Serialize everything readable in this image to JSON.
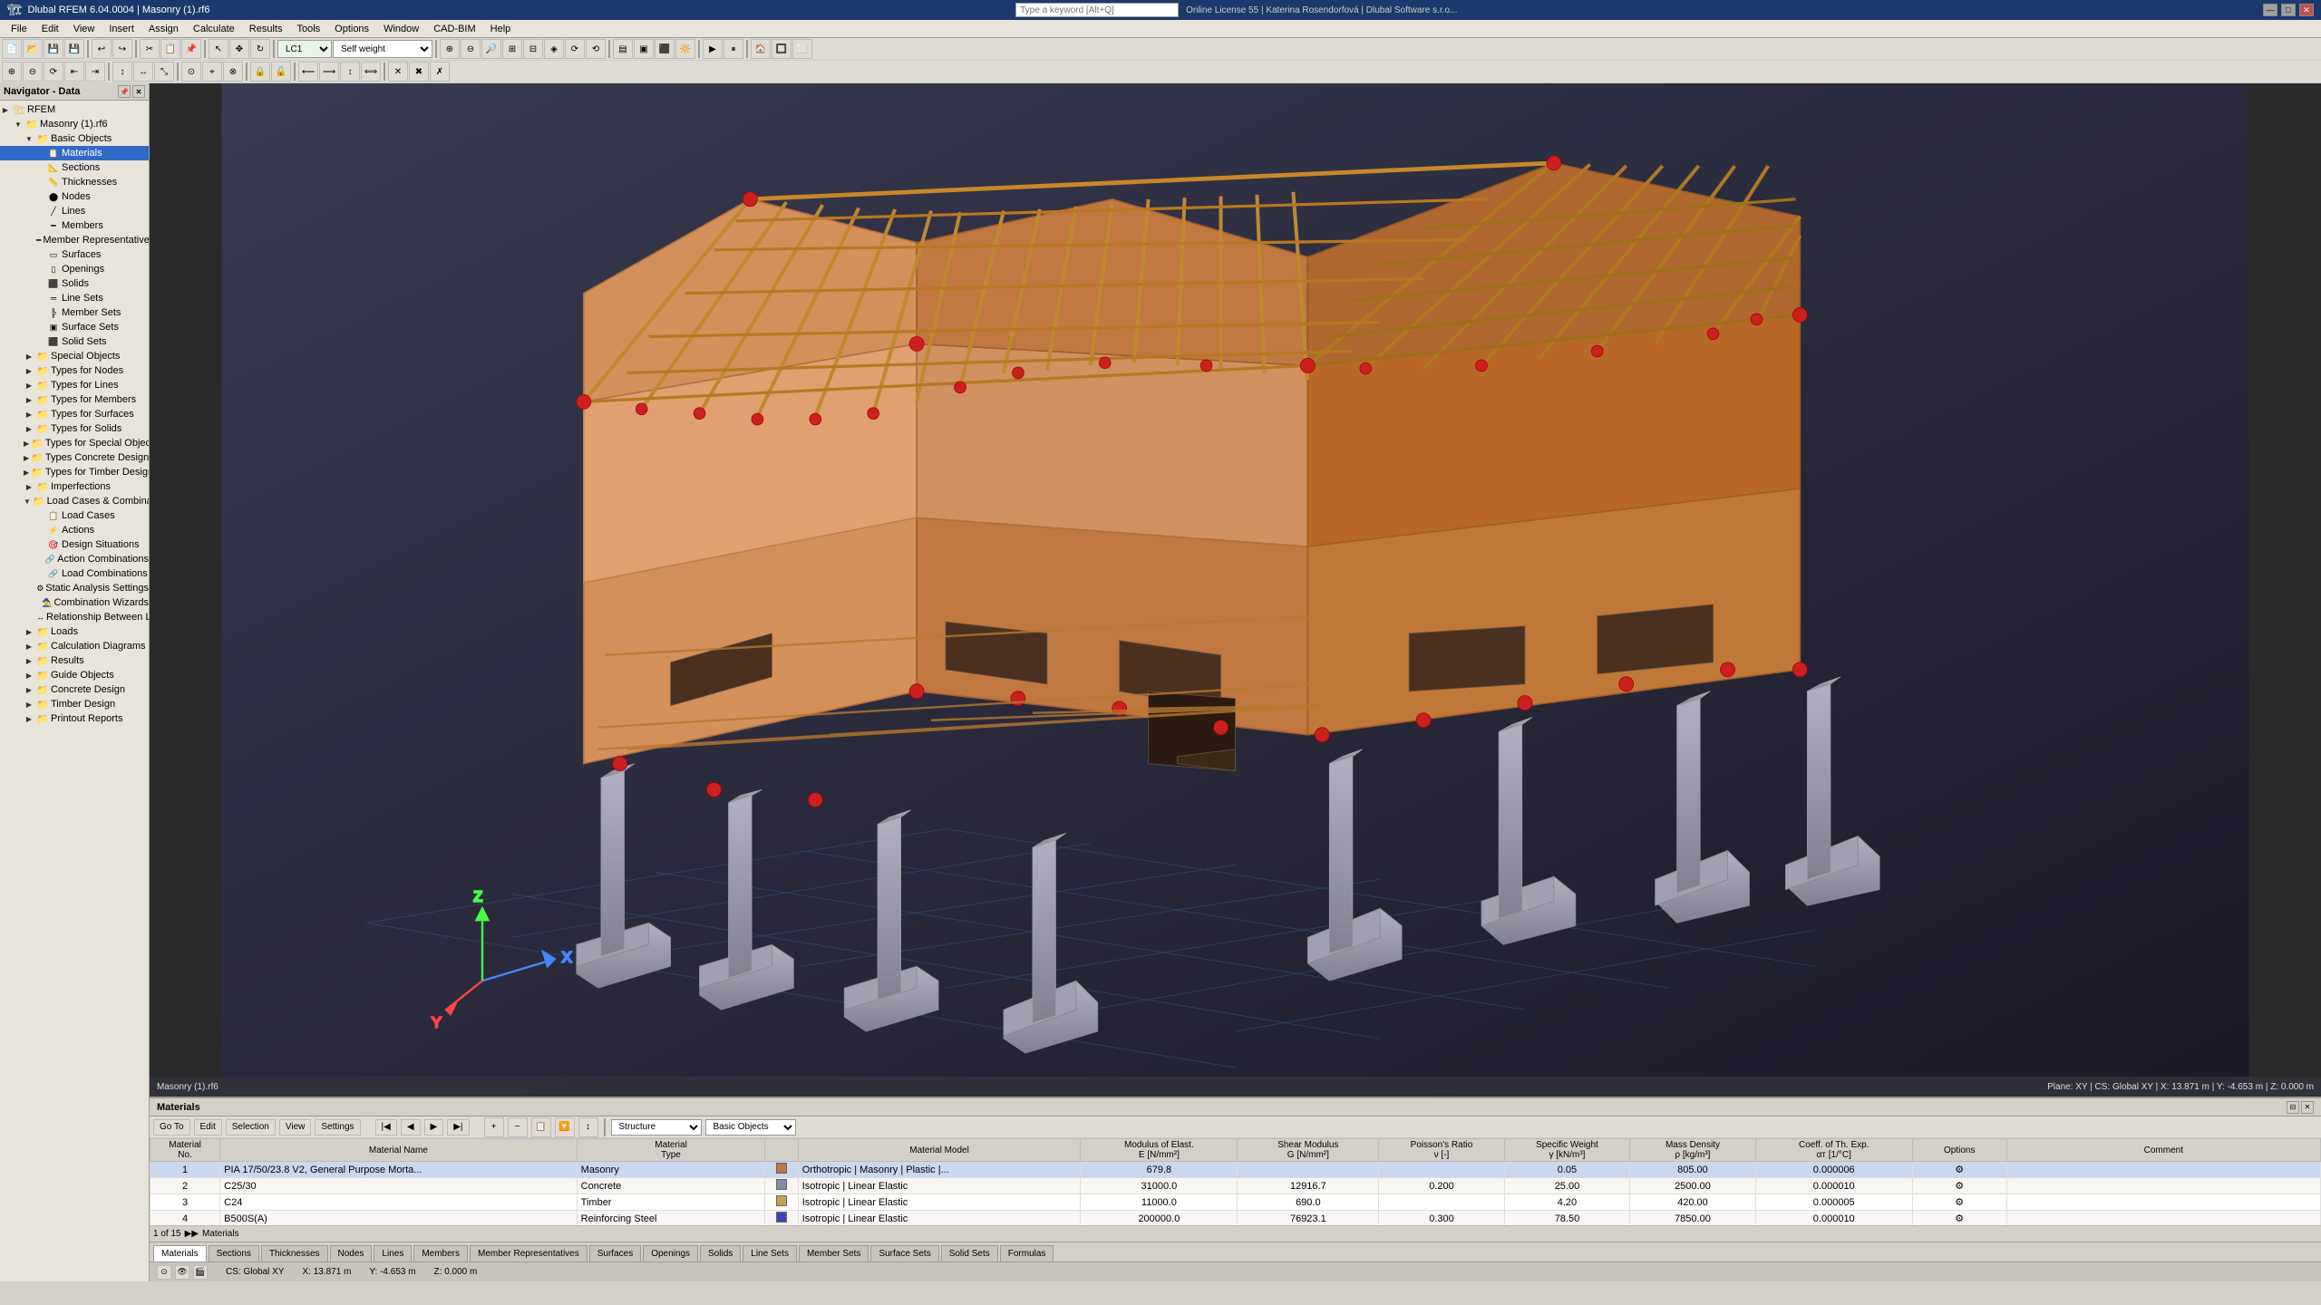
{
  "app": {
    "title": "Dlubal RFEM 6.04.0004 | Masonry (1).rf6",
    "title_full": "Dlubal RFEM 6.04.0004 | Masonry (1).rf6"
  },
  "title_bar": {
    "title": "Dlubal RFEM 6.04.0004 | Masonry (1).rf6",
    "minimize": "—",
    "maximize": "□",
    "close": "✕"
  },
  "menu": {
    "items": [
      "File",
      "Edit",
      "View",
      "Insert",
      "Assign",
      "Calculate",
      "Results",
      "Tools",
      "Options",
      "Window",
      "CAD-BIM",
      "Help"
    ]
  },
  "search": {
    "placeholder": "Type a keyword [Alt+Q]"
  },
  "license": {
    "text": "Online License 55 | Katerina Rosendorfová | Dlubal Software s.r.o..."
  },
  "navigator": {
    "title": "Navigator - Data",
    "root": "RFEM",
    "model": "Masonry (1).rf6",
    "tree": [
      {
        "id": "basic-objects",
        "label": "Basic Objects",
        "level": 1,
        "expanded": true,
        "type": "folder"
      },
      {
        "id": "materials",
        "label": "Materials",
        "level": 2,
        "type": "item",
        "selected": true
      },
      {
        "id": "sections",
        "label": "Sections",
        "level": 2,
        "type": "item"
      },
      {
        "id": "thicknesses",
        "label": "Thicknesses",
        "level": 2,
        "type": "item"
      },
      {
        "id": "nodes",
        "label": "Nodes",
        "level": 2,
        "type": "item"
      },
      {
        "id": "lines",
        "label": "Lines",
        "level": 2,
        "type": "item"
      },
      {
        "id": "members",
        "label": "Members",
        "level": 2,
        "type": "item"
      },
      {
        "id": "member-representatives",
        "label": "Member Representatives",
        "level": 2,
        "type": "item"
      },
      {
        "id": "surfaces",
        "label": "Surfaces",
        "level": 2,
        "type": "item"
      },
      {
        "id": "openings",
        "label": "Openings",
        "level": 2,
        "type": "item"
      },
      {
        "id": "solids",
        "label": "Solids",
        "level": 2,
        "type": "item"
      },
      {
        "id": "line-sets",
        "label": "Line Sets",
        "level": 2,
        "type": "item"
      },
      {
        "id": "member-sets",
        "label": "Member Sets",
        "level": 2,
        "type": "item"
      },
      {
        "id": "surface-sets",
        "label": "Surface Sets",
        "level": 2,
        "type": "item"
      },
      {
        "id": "solid-sets",
        "label": "Solid Sets",
        "level": 2,
        "type": "item"
      },
      {
        "id": "special-objects",
        "label": "Special Objects",
        "level": 1,
        "expanded": false,
        "type": "folder"
      },
      {
        "id": "types-for-nodes",
        "label": "Types for Nodes",
        "level": 1,
        "expanded": false,
        "type": "folder"
      },
      {
        "id": "types-for-lines",
        "label": "Types for Lines",
        "level": 1,
        "type": "folder"
      },
      {
        "id": "types-for-members",
        "label": "Types for Members",
        "level": 1,
        "type": "folder"
      },
      {
        "id": "types-for-surfaces",
        "label": "Types for Surfaces",
        "level": 1,
        "type": "folder"
      },
      {
        "id": "types-for-solids",
        "label": "Types for Solids",
        "level": 1,
        "type": "folder"
      },
      {
        "id": "types-for-special-objects",
        "label": "Types for Special Objects",
        "level": 1,
        "type": "folder"
      },
      {
        "id": "types-concrete-design",
        "label": "Types Concrete Design",
        "level": 1,
        "type": "folder"
      },
      {
        "id": "types-timber-design",
        "label": "Types for Timber Design",
        "level": 1,
        "type": "folder"
      },
      {
        "id": "imperfections",
        "label": "Imperfections",
        "level": 1,
        "type": "folder"
      },
      {
        "id": "load-cases-combinations",
        "label": "Load Cases & Combinations",
        "level": 1,
        "expanded": true,
        "type": "folder"
      },
      {
        "id": "load-cases",
        "label": "Load Cases",
        "level": 2,
        "type": "item"
      },
      {
        "id": "actions",
        "label": "Actions",
        "level": 2,
        "type": "item"
      },
      {
        "id": "design-situations",
        "label": "Design Situations",
        "level": 2,
        "type": "item"
      },
      {
        "id": "action-combinations",
        "label": "Action Combinations",
        "level": 2,
        "type": "item"
      },
      {
        "id": "load-combinations",
        "label": "Load Combinations",
        "level": 2,
        "type": "item"
      },
      {
        "id": "static-analysis-settings",
        "label": "Static Analysis Settings",
        "level": 2,
        "type": "item"
      },
      {
        "id": "combination-wizards",
        "label": "Combination Wizards",
        "level": 2,
        "type": "item"
      },
      {
        "id": "relationship-between-load-cases",
        "label": "Relationship Between Load Cases",
        "level": 2,
        "type": "item"
      },
      {
        "id": "loads",
        "label": "Loads",
        "level": 1,
        "type": "folder"
      },
      {
        "id": "calculation-diagrams",
        "label": "Calculation Diagrams",
        "level": 1,
        "type": "folder"
      },
      {
        "id": "results",
        "label": "Results",
        "level": 1,
        "type": "folder"
      },
      {
        "id": "guide-objects",
        "label": "Guide Objects",
        "level": 1,
        "type": "folder"
      },
      {
        "id": "concrete-design",
        "label": "Concrete Design",
        "level": 1,
        "type": "folder"
      },
      {
        "id": "timber-design",
        "label": "Timber Design",
        "level": 1,
        "type": "folder"
      },
      {
        "id": "printout-reports",
        "label": "Printout Reports",
        "level": 1,
        "type": "folder"
      }
    ]
  },
  "lc_selector": {
    "code": "LC1",
    "name": "Self weight"
  },
  "bottom_panel": {
    "title": "Materials",
    "nav_buttons": [
      "Go To",
      "Edit",
      "Selection",
      "View",
      "Settings"
    ],
    "filter_combo": "Structure",
    "filter_combo2": "Basic Objects",
    "page_info": "1 of 15",
    "columns": [
      {
        "key": "no",
        "label": "Material No."
      },
      {
        "key": "name",
        "label": "Material Name"
      },
      {
        "key": "type",
        "label": "Material Type"
      },
      {
        "key": "color",
        "label": ""
      },
      {
        "key": "model",
        "label": "Material Model"
      },
      {
        "key": "e_modulus",
        "label": "Modulus of Elast. E [N/mm²]"
      },
      {
        "key": "g_modulus",
        "label": "Shear Modulus G [N/mm²]"
      },
      {
        "key": "poisson",
        "label": "Poisson's Ratio ν [-]"
      },
      {
        "key": "specific_weight",
        "label": "Specific Weight γ [kN/m³]"
      },
      {
        "key": "mass_density",
        "label": "Mass Density ρ [kg/m³]"
      },
      {
        "key": "coeff_th_exp",
        "label": "Coeff. of Th. Exp. αт [1/°C]"
      },
      {
        "key": "options",
        "label": "Options"
      },
      {
        "key": "comment",
        "label": "Comment"
      }
    ],
    "rows": [
      {
        "no": "1",
        "name": "PIA 17/50/23.8 V2, General Purpose Morta...",
        "type": "Masonry",
        "color": "#c87040",
        "model": "Orthotropic | Masonry | Plastic |...",
        "e_modulus": "679.8",
        "g_modulus": "",
        "poisson": "",
        "specific_weight": "0.05",
        "mass_density": "805.00",
        "coeff_th_exp": "0.000006",
        "options": "⚙",
        "comment": ""
      },
      {
        "no": "2",
        "name": "C25/30",
        "type": "Concrete",
        "color": "#8888aa",
        "model": "Isotropic | Linear Elastic",
        "e_modulus": "31000.0",
        "g_modulus": "12916.7",
        "poisson": "0.200",
        "specific_weight": "25.00",
        "mass_density": "2500.00",
        "coeff_th_exp": "0.000010",
        "options": "⚙",
        "comment": ""
      },
      {
        "no": "3",
        "name": "C24",
        "type": "Timber",
        "color": "#c8a050",
        "model": "Isotropic | Linear Elastic",
        "e_modulus": "11000.0",
        "g_modulus": "690.0",
        "poisson": "",
        "specific_weight": "4.20",
        "mass_density": "420.00",
        "coeff_th_exp": "0.000005",
        "options": "⚙",
        "comment": ""
      },
      {
        "no": "4",
        "name": "B500S(A)",
        "type": "Reinforcing Steel",
        "color": "#4040c0",
        "model": "Isotropic | Linear Elastic",
        "e_modulus": "200000.0",
        "g_modulus": "76923.1",
        "poisson": "0.300",
        "specific_weight": "78.50",
        "mass_density": "7850.00",
        "coeff_th_exp": "0.000010",
        "options": "⚙",
        "comment": ""
      }
    ]
  },
  "bottom_tabs": [
    "Materials",
    "Sections",
    "Thicknesses",
    "Nodes",
    "Lines",
    "Members",
    "Member Representatives",
    "Surfaces",
    "Openings",
    "Solids",
    "Line Sets",
    "Member Sets",
    "Surface Sets",
    "Solid Sets",
    "Formulas"
  ],
  "status_bar": {
    "coords": "CS: Global XY",
    "x": "X: 13.871 m",
    "y": "Y: -4.653 m",
    "z": "Z: 0.000 m"
  },
  "viewport_toolbar_items": [
    "⊕",
    "⊖",
    "↻",
    "↺",
    "⇱",
    "⊞",
    "⊟",
    "◈",
    "⊕",
    "⊖"
  ],
  "model_stats": {
    "plane": "Plane: XY"
  }
}
